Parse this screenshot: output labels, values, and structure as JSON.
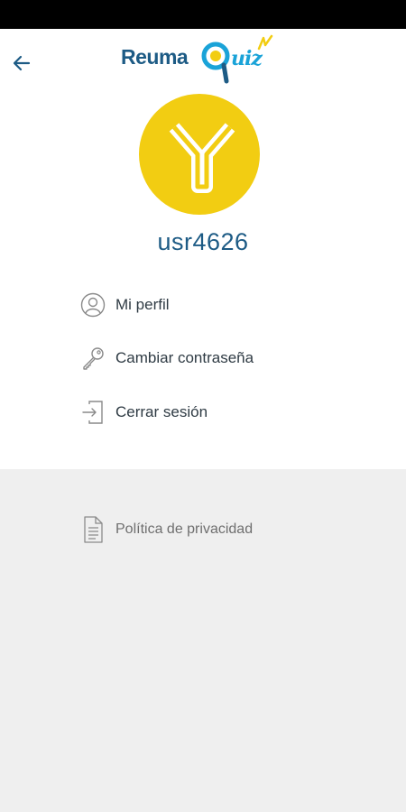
{
  "colors": {
    "brand_blue": "#1d5b85",
    "accent_yellow": "#f2cd12",
    "accent_cyan": "#1aa3d8",
    "icon_gray": "#8a8a8a"
  },
  "header": {
    "back_icon": "arrow-left-icon",
    "logo": {
      "text_left": "Reuma",
      "text_q": "q",
      "text_right": "uiz"
    }
  },
  "profile": {
    "avatar_icon": "antibody-y-icon",
    "username": "usr4626"
  },
  "menu": {
    "items": [
      {
        "icon": "user-circle-icon",
        "label": "Mi perfil"
      },
      {
        "icon": "key-icon",
        "label": "Cambiar contraseña"
      },
      {
        "icon": "logout-icon",
        "label": "Cerrar sesión"
      }
    ]
  },
  "footer": {
    "privacy": {
      "icon": "document-icon",
      "label": "Política de privacidad"
    }
  }
}
